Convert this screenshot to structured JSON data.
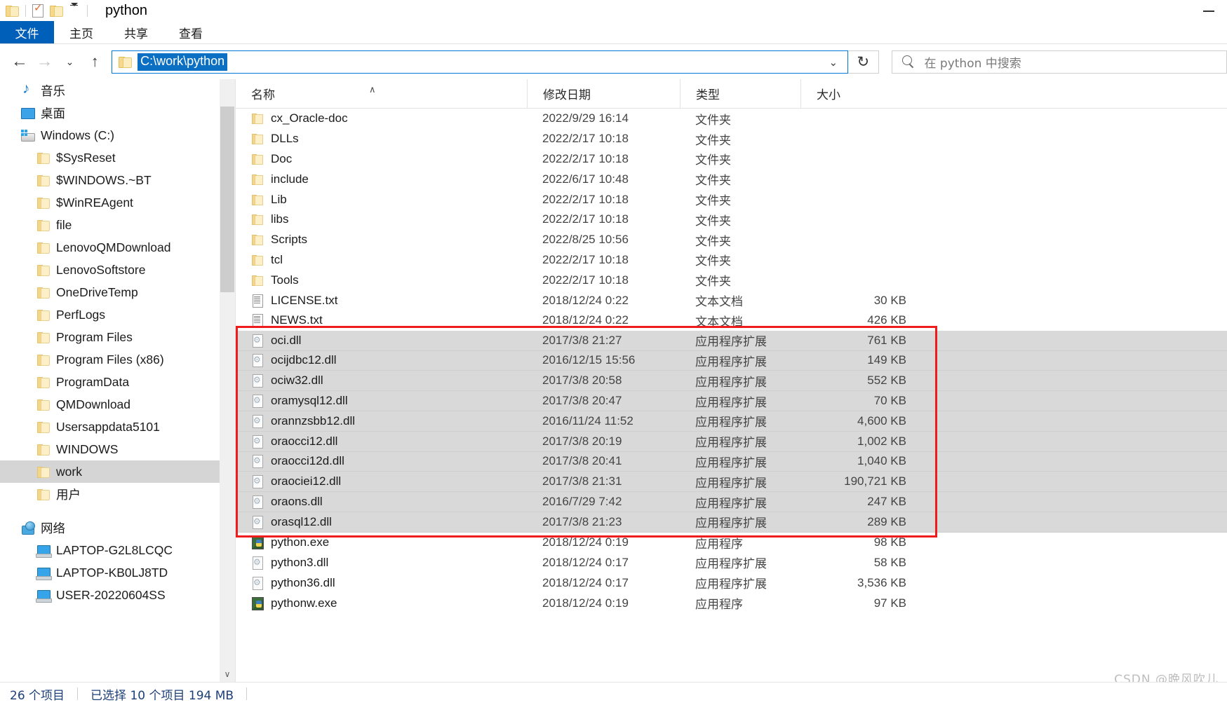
{
  "window": {
    "title": "python",
    "quick_access": [
      "folder-icon",
      "properties-icon",
      "new-folder-icon"
    ],
    "customize_caret": "▾",
    "minimize": "—"
  },
  "ribbon": {
    "tabs": [
      {
        "label": "文件",
        "active": true
      },
      {
        "label": "主页",
        "active": false
      },
      {
        "label": "共享",
        "active": false
      },
      {
        "label": "查看",
        "active": false
      }
    ]
  },
  "nav": {
    "back": "←",
    "forward": "→",
    "recent": "⌄",
    "up": "↑",
    "address_path": "C:\\work\\python",
    "address_caret": "⌄",
    "refresh": "↻"
  },
  "search": {
    "placeholder": "在 python 中搜索",
    "icon": "search-icon"
  },
  "sidebar": {
    "items": [
      {
        "label": "音乐",
        "icon": "music",
        "indent": 1,
        "selected": false
      },
      {
        "label": "桌面",
        "icon": "desktop",
        "indent": 1,
        "selected": false
      },
      {
        "label": "Windows (C:)",
        "icon": "drive",
        "indent": 1,
        "selected": false
      },
      {
        "label": "$SysReset",
        "icon": "folder",
        "indent": 2,
        "selected": false
      },
      {
        "label": "$WINDOWS.~BT",
        "icon": "folder",
        "indent": 2,
        "selected": false
      },
      {
        "label": "$WinREAgent",
        "icon": "folder",
        "indent": 2,
        "selected": false
      },
      {
        "label": "file",
        "icon": "folder",
        "indent": 2,
        "selected": false
      },
      {
        "label": "LenovoQMDownload",
        "icon": "folder",
        "indent": 2,
        "selected": false
      },
      {
        "label": "LenovoSoftstore",
        "icon": "folder",
        "indent": 2,
        "selected": false
      },
      {
        "label": "OneDriveTemp",
        "icon": "folder",
        "indent": 2,
        "selected": false
      },
      {
        "label": "PerfLogs",
        "icon": "folder",
        "indent": 2,
        "selected": false
      },
      {
        "label": "Program Files",
        "icon": "folder",
        "indent": 2,
        "selected": false
      },
      {
        "label": "Program Files (x86)",
        "icon": "folder",
        "indent": 2,
        "selected": false
      },
      {
        "label": "ProgramData",
        "icon": "folder",
        "indent": 2,
        "selected": false
      },
      {
        "label": "QMDownload",
        "icon": "folder",
        "indent": 2,
        "selected": false
      },
      {
        "label": "Usersappdata5101",
        "icon": "folder",
        "indent": 2,
        "selected": false
      },
      {
        "label": "WINDOWS",
        "icon": "folder",
        "indent": 2,
        "selected": false
      },
      {
        "label": "work",
        "icon": "folder",
        "indent": 2,
        "selected": true
      },
      {
        "label": "用户",
        "icon": "folder",
        "indent": 2,
        "selected": false
      },
      {
        "label": "",
        "icon": "spacer",
        "indent": 1,
        "selected": false
      },
      {
        "label": "网络",
        "icon": "network",
        "indent": 1,
        "selected": false
      },
      {
        "label": "LAPTOP-G2L8LCQC",
        "icon": "pc",
        "indent": 2,
        "selected": false
      },
      {
        "label": "LAPTOP-KB0LJ8TD",
        "icon": "pc",
        "indent": 2,
        "selected": false
      },
      {
        "label": "USER-20220604SS",
        "icon": "pc",
        "indent": 2,
        "selected": false
      }
    ],
    "scroll_up": "∧",
    "scroll_down": "∨"
  },
  "filelist": {
    "columns": [
      {
        "label": "名称",
        "key": "name"
      },
      {
        "label": "修改日期",
        "key": "date"
      },
      {
        "label": "类型",
        "key": "type"
      },
      {
        "label": "大小",
        "key": "size"
      }
    ],
    "sort_indicator": "∧",
    "rows": [
      {
        "name": "cx_Oracle-doc",
        "date": "2022/9/29 16:14",
        "type": "文件夹",
        "size": "",
        "icon": "folder",
        "selected": false
      },
      {
        "name": "DLLs",
        "date": "2022/2/17 10:18",
        "type": "文件夹",
        "size": "",
        "icon": "folder",
        "selected": false
      },
      {
        "name": "Doc",
        "date": "2022/2/17 10:18",
        "type": "文件夹",
        "size": "",
        "icon": "folder",
        "selected": false
      },
      {
        "name": "include",
        "date": "2022/6/17 10:48",
        "type": "文件夹",
        "size": "",
        "icon": "folder",
        "selected": false
      },
      {
        "name": "Lib",
        "date": "2022/2/17 10:18",
        "type": "文件夹",
        "size": "",
        "icon": "folder",
        "selected": false
      },
      {
        "name": "libs",
        "date": "2022/2/17 10:18",
        "type": "文件夹",
        "size": "",
        "icon": "folder",
        "selected": false
      },
      {
        "name": "Scripts",
        "date": "2022/8/25 10:56",
        "type": "文件夹",
        "size": "",
        "icon": "folder",
        "selected": false
      },
      {
        "name": "tcl",
        "date": "2022/2/17 10:18",
        "type": "文件夹",
        "size": "",
        "icon": "folder",
        "selected": false
      },
      {
        "name": "Tools",
        "date": "2022/2/17 10:18",
        "type": "文件夹",
        "size": "",
        "icon": "folder",
        "selected": false
      },
      {
        "name": "LICENSE.txt",
        "date": "2018/12/24 0:22",
        "type": "文本文档",
        "size": "30 KB",
        "icon": "txt",
        "selected": false
      },
      {
        "name": "NEWS.txt",
        "date": "2018/12/24 0:22",
        "type": "文本文档",
        "size": "426 KB",
        "icon": "txt",
        "selected": false
      },
      {
        "name": "oci.dll",
        "date": "2017/3/8 21:27",
        "type": "应用程序扩展",
        "size": "761 KB",
        "icon": "dll",
        "selected": true
      },
      {
        "name": "ocijdbc12.dll",
        "date": "2016/12/15 15:56",
        "type": "应用程序扩展",
        "size": "149 KB",
        "icon": "dll",
        "selected": true
      },
      {
        "name": "ociw32.dll",
        "date": "2017/3/8 20:58",
        "type": "应用程序扩展",
        "size": "552 KB",
        "icon": "dll",
        "selected": true
      },
      {
        "name": "oramysql12.dll",
        "date": "2017/3/8 20:47",
        "type": "应用程序扩展",
        "size": "70 KB",
        "icon": "dll",
        "selected": true
      },
      {
        "name": "orannzsbb12.dll",
        "date": "2016/11/24 11:52",
        "type": "应用程序扩展",
        "size": "4,600 KB",
        "icon": "dll",
        "selected": true
      },
      {
        "name": "oraocci12.dll",
        "date": "2017/3/8 20:19",
        "type": "应用程序扩展",
        "size": "1,002 KB",
        "icon": "dll",
        "selected": true
      },
      {
        "name": "oraocci12d.dll",
        "date": "2017/3/8 20:41",
        "type": "应用程序扩展",
        "size": "1,040 KB",
        "icon": "dll",
        "selected": true
      },
      {
        "name": "oraociei12.dll",
        "date": "2017/3/8 21:31",
        "type": "应用程序扩展",
        "size": "190,721 KB",
        "icon": "dll",
        "selected": true
      },
      {
        "name": "oraons.dll",
        "date": "2016/7/29 7:42",
        "type": "应用程序扩展",
        "size": "247 KB",
        "icon": "dll",
        "selected": true
      },
      {
        "name": "orasql12.dll",
        "date": "2017/3/8 21:23",
        "type": "应用程序扩展",
        "size": "289 KB",
        "icon": "dll",
        "selected": true
      },
      {
        "name": "python.exe",
        "date": "2018/12/24 0:19",
        "type": "应用程序",
        "size": "98 KB",
        "icon": "exe",
        "selected": false
      },
      {
        "name": "python3.dll",
        "date": "2018/12/24 0:17",
        "type": "应用程序扩展",
        "size": "58 KB",
        "icon": "dll",
        "selected": false
      },
      {
        "name": "python36.dll",
        "date": "2018/12/24 0:17",
        "type": "应用程序扩展",
        "size": "3,536 KB",
        "icon": "dll",
        "selected": false
      },
      {
        "name": "pythonw.exe",
        "date": "2018/12/24 0:19",
        "type": "应用程序",
        "size": "97 KB",
        "icon": "exe",
        "selected": false
      }
    ]
  },
  "annotation": {
    "color": "#ee1c1c"
  },
  "watermark": {
    "text": "CSDN @晩风吹儿"
  },
  "statusbar": {
    "item_count": "26 个项目",
    "selection": "已选择 10 个项目  194 MB"
  }
}
